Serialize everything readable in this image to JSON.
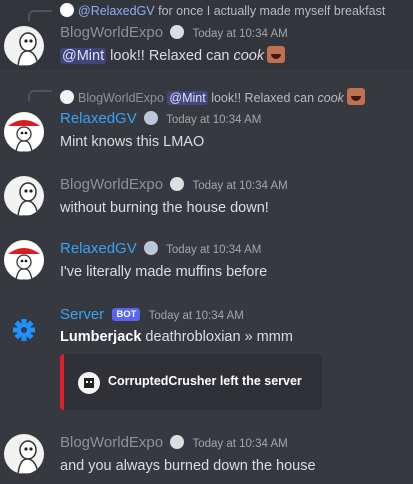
{
  "colors": {
    "background": "#36393f",
    "username_gray": "#8e9297",
    "username_blue": "#3ba2f5",
    "mention_bg": "#5865f2",
    "embed_border": "#e01f2a",
    "bot_badge": "#5865f2"
  },
  "messages": [
    {
      "reply": {
        "username": "@RelaxedGV",
        "text": "for once I actually made myself breakfast"
      },
      "username": "BlogWorldExpo",
      "timestamp": "Today at 10:34 AM",
      "mention": "@Mint",
      "text": " look!! Relaxed can ",
      "text_italic": "cook"
    },
    {
      "reply": {
        "username": "BlogWorldExpo",
        "mention": "@Mint",
        "text": " look!! Relaxed can ",
        "text_italic": "cook"
      },
      "username": "RelaxedGV",
      "timestamp": "Today at 10:34 AM",
      "text": "Mint knows this LMAO"
    },
    {
      "username": "BlogWorldExpo",
      "timestamp": "Today at 10:34 AM",
      "text": "without burning the house down!"
    },
    {
      "username": "RelaxedGV",
      "timestamp": "Today at 10:34 AM",
      "text": "I've literally made muffins before"
    },
    {
      "username": "Server",
      "badge": "BOT",
      "timestamp": "Today at 10:34 AM",
      "bold_text": "Lumberjack",
      "text": " deathrobloxian » mmm",
      "embed": {
        "text": "CorruptedCrusher left the server"
      }
    },
    {
      "username": "BlogWorldExpo",
      "timestamp": "Today at 10:34 AM",
      "text": "and you always burned down the house"
    }
  ]
}
